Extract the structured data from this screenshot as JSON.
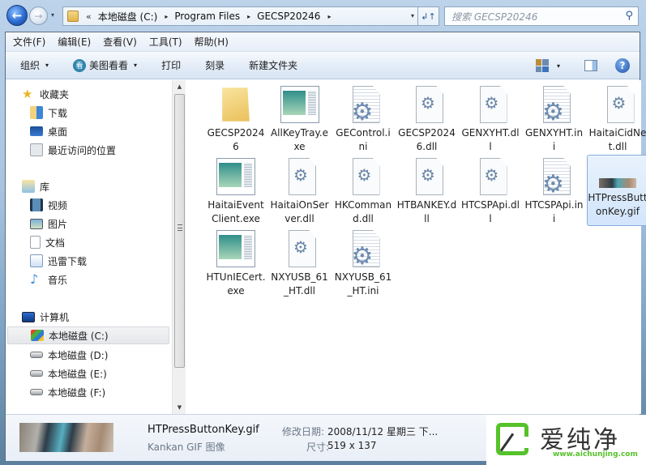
{
  "nav": {
    "back_label": "←",
    "forward_label": "→",
    "recent_label": "▾"
  },
  "address": {
    "overflow": "«",
    "crumbs": [
      "本地磁盘 (C:)",
      "Program Files",
      "GECSP20246"
    ],
    "separator": "▸",
    "dropdown": "▾",
    "refresh": "↲↑"
  },
  "search": {
    "placeholder": "搜索 GECSP20246",
    "icon": "⚲"
  },
  "menubar": [
    "文件(F)",
    "编辑(E)",
    "查看(V)",
    "工具(T)",
    "帮助(H)"
  ],
  "toolbar": {
    "organize": "组织",
    "meitu": "美图看看",
    "meitu_glyph": "看",
    "print": "打印",
    "burn": "刻录",
    "new_folder": "新建文件夹",
    "caret": "▾",
    "help_glyph": "?"
  },
  "sidebar": {
    "favorites": {
      "label": "收藏夹",
      "items": [
        "下载",
        "桌面",
        "最近访问的位置"
      ]
    },
    "libraries": {
      "label": "库",
      "items": [
        "视频",
        "图片",
        "文档",
        "迅雷下载",
        "音乐"
      ]
    },
    "computer": {
      "label": "计算机",
      "items": [
        "本地磁盘 (C:)",
        "本地磁盘 (D:)",
        "本地磁盘 (E:)",
        "本地磁盘 (F:)"
      ],
      "selected": "本地磁盘 (C:)"
    },
    "scroll_up": "▲",
    "scroll_down": "▼"
  },
  "files": [
    {
      "name": "GECSP20246",
      "type": "folder"
    },
    {
      "name": "AllKeyTray.exe",
      "type": "exe"
    },
    {
      "name": "GEControl.ini",
      "type": "ini"
    },
    {
      "name": "GECSP20246.dll",
      "type": "dll"
    },
    {
      "name": "GENXYHT.dll",
      "type": "dll"
    },
    {
      "name": "GENXYHT.ini",
      "type": "ini"
    },
    {
      "name": "HaitaiCidNet.dll",
      "type": "dll"
    },
    {
      "name": "HaitaiEventClient.exe",
      "type": "exe"
    },
    {
      "name": "HaitaiOnServer.dll",
      "type": "dll"
    },
    {
      "name": "HKCommand.dll",
      "type": "dll"
    },
    {
      "name": "HTBANKEY.dll",
      "type": "dll"
    },
    {
      "name": "HTCSPApi.dll",
      "type": "dll"
    },
    {
      "name": "HTCSPApi.ini",
      "type": "ini"
    },
    {
      "name": "HTPressButtonKey.gif",
      "type": "gif",
      "selected": true
    },
    {
      "name": "HTUnIECert.exe",
      "type": "exe"
    },
    {
      "name": "NXYUSB_61_HT.dll",
      "type": "dll"
    },
    {
      "name": "NXYUSB_61_HT.ini",
      "type": "ini"
    }
  ],
  "details": {
    "name": "HTPressButtonKey.gif",
    "modified_label": "修改日期:",
    "modified": "2008/11/12 星期三 下...",
    "type": "Kankan GIF 图像",
    "size_label": "尺寸:",
    "size": "519 x 137"
  },
  "watermark": {
    "text": "爱纯净",
    "url": "www.aichunjing.com"
  }
}
